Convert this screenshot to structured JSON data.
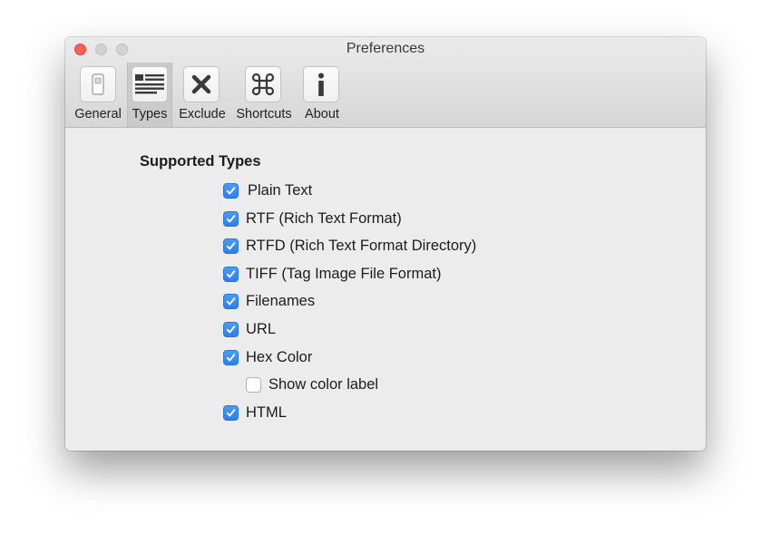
{
  "window": {
    "title": "Preferences"
  },
  "toolbar": {
    "items": [
      {
        "label": "General",
        "icon": "toggle-switch-icon",
        "selected": false
      },
      {
        "label": "Types",
        "icon": "list-icon",
        "selected": true
      },
      {
        "label": "Exclude",
        "icon": "x-icon",
        "selected": false
      },
      {
        "label": "Shortcuts",
        "icon": "command-icon",
        "selected": false
      },
      {
        "label": "About",
        "icon": "info-icon",
        "selected": false
      }
    ]
  },
  "main": {
    "heading": "Supported Types",
    "options": [
      {
        "label": "Plain Text",
        "checked": true
      },
      {
        "label": "RTF (Rich Text Format)",
        "checked": true
      },
      {
        "label": "RTFD (Rich Text Format Directory)",
        "checked": true
      },
      {
        "label": "TIFF (Tag Image File Format)",
        "checked": true
      },
      {
        "label": "Filenames",
        "checked": true
      },
      {
        "label": "URL",
        "checked": true
      },
      {
        "label": "Hex Color",
        "checked": true
      },
      {
        "label": "Show color label",
        "checked": false
      },
      {
        "label": "HTML",
        "checked": true
      }
    ]
  },
  "colors": {
    "checkbox_checked": "#2b7ef0",
    "close_button": "#fc5f57",
    "window_background": "#ececec"
  }
}
